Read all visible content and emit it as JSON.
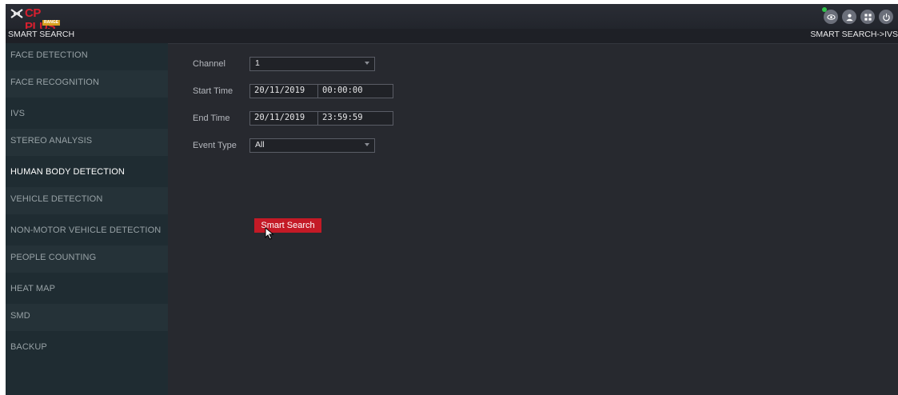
{
  "brand": {
    "logo_text": "CP PLUS",
    "logo_badge": "RANGE"
  },
  "header": {
    "title": "SMART SEARCH",
    "breadcrumb": "SMART SEARCH->IVS"
  },
  "top_icons": [
    "live-view-icon",
    "user-icon",
    "grid-menu-icon",
    "power-icon"
  ],
  "sidebar": {
    "items": [
      {
        "label": "FACE DETECTION"
      },
      {
        "label": "FACE RECOGNITION"
      },
      {
        "label": "IVS"
      },
      {
        "label": "STEREO ANALYSIS"
      },
      {
        "label": "HUMAN BODY DETECTION"
      },
      {
        "label": "VEHICLE DETECTION"
      },
      {
        "label": "NON-MOTOR VEHICLE DETECTION"
      },
      {
        "label": "PEOPLE COUNTING"
      },
      {
        "label": "HEAT MAP"
      },
      {
        "label": "SMD"
      },
      {
        "label": "BACKUP"
      }
    ],
    "active": "HUMAN BODY DETECTION"
  },
  "form": {
    "channel": {
      "label": "Channel",
      "value": "1"
    },
    "start_time": {
      "label": "Start Time",
      "date": "20/11/2019",
      "time": "00:00:00"
    },
    "end_time": {
      "label": "End Time",
      "date": "20/11/2019",
      "time": "23:59:59"
    },
    "event_type": {
      "label": "Event Type",
      "value": "All"
    },
    "search_label": "Smart Search"
  },
  "colors": {
    "accent": "#c41a26",
    "brand": "#d81f2f",
    "live": "#31c24a"
  }
}
